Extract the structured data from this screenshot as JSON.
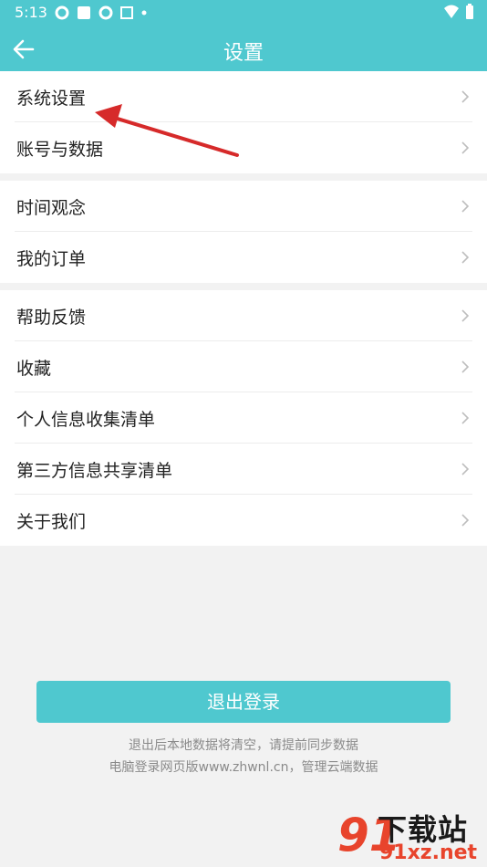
{
  "status_bar": {
    "time": "5:13"
  },
  "header": {
    "title": "设置"
  },
  "groups": [
    {
      "items": [
        {
          "label": "系统设置"
        },
        {
          "label": "账号与数据"
        }
      ]
    },
    {
      "items": [
        {
          "label": "时间观念"
        },
        {
          "label": "我的订单"
        }
      ]
    },
    {
      "items": [
        {
          "label": "帮助反馈"
        },
        {
          "label": "收藏"
        },
        {
          "label": "个人信息收集清单"
        },
        {
          "label": "第三方信息共享清单"
        },
        {
          "label": "关于我们"
        }
      ]
    }
  ],
  "logout": {
    "label": "退出登录",
    "note_line1": "退出后本地数据将清空，请提前同步数据",
    "note_line2": "电脑登录网页版www.zhwnl.cn，管理云端数据"
  },
  "watermark": {
    "text_big": "下载站",
    "text_small": "91xz.net",
    "logo": "91"
  },
  "colors": {
    "accent": "#4fc8cf",
    "annotation_arrow": "#d62a2a"
  }
}
